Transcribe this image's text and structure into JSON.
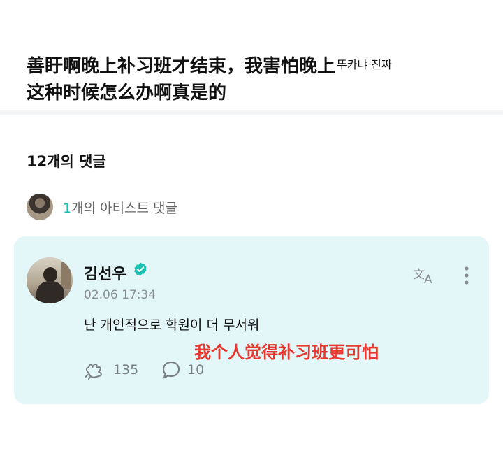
{
  "post": {
    "text_main": "善盱啊晚上补习班才结束，我害怕晚上",
    "text_inline": "뚜카냐 진짜",
    "text_line2": "这种时候怎么办啊真是的"
  },
  "comments": {
    "count_label": "12개의 댓글",
    "artist_count": "1",
    "artist_label_rest": "개의 아티스트 댓글"
  },
  "comment": {
    "author": "김선우",
    "timestamp": "02.06 17:34",
    "body": "난 개인적으로 학원이 더 무서워",
    "translation": "我个人觉得补习班更可怕",
    "likes": "135",
    "replies": "10"
  },
  "colors": {
    "accent": "#16c3b2",
    "card_bg": "#e3f7f8",
    "overlay_red": "#e8372f"
  },
  "icons": [
    "verified-icon",
    "translate-icon",
    "more-icon",
    "like-icon",
    "reply-icon"
  ]
}
